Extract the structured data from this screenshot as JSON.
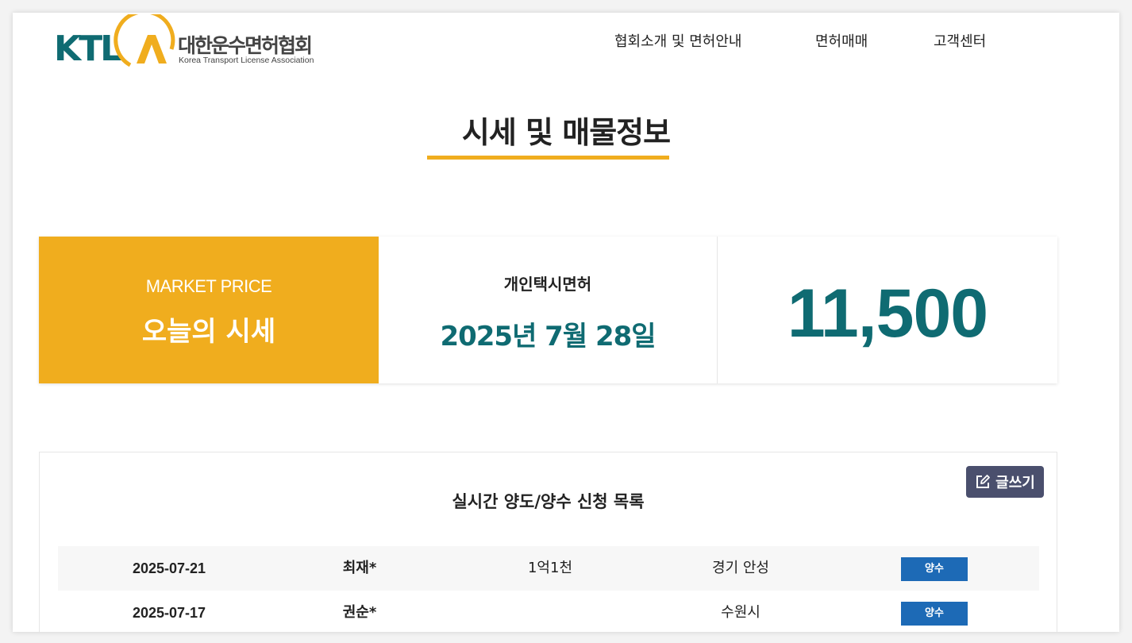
{
  "header": {
    "logo_mark": "KTL",
    "logo_text": "대한운수면허협회",
    "logo_sub": "Korea Transport License Association",
    "nav": [
      {
        "label": "협회소개 및 면허안내"
      },
      {
        "label": "면허매매"
      },
      {
        "label": "고객센터"
      }
    ]
  },
  "page": {
    "title": "시세 및 매물정보"
  },
  "market": {
    "en_label": "MARKET PRICE",
    "ko_label": "오늘의 시세",
    "license_type": "개인택시면허",
    "date": "2025년 7월 28일",
    "price": "11,500"
  },
  "list": {
    "title": "실시간 양도/양수 신청 목록",
    "write_label": "글쓰기",
    "rows": [
      {
        "date": "2025-07-21",
        "name": "최재*",
        "price": "1억1천",
        "region": "경기 안성",
        "type": "양수"
      },
      {
        "date": "2025-07-17",
        "name": "권순*",
        "price": "",
        "region": "수원시",
        "type": "양수"
      }
    ]
  },
  "colors": {
    "accent": "#f0ad1e",
    "teal": "#0f6b72",
    "badge": "#1d6ab6",
    "button": "#4a4f6d"
  },
  "icons": {
    "write": "edit-icon"
  }
}
